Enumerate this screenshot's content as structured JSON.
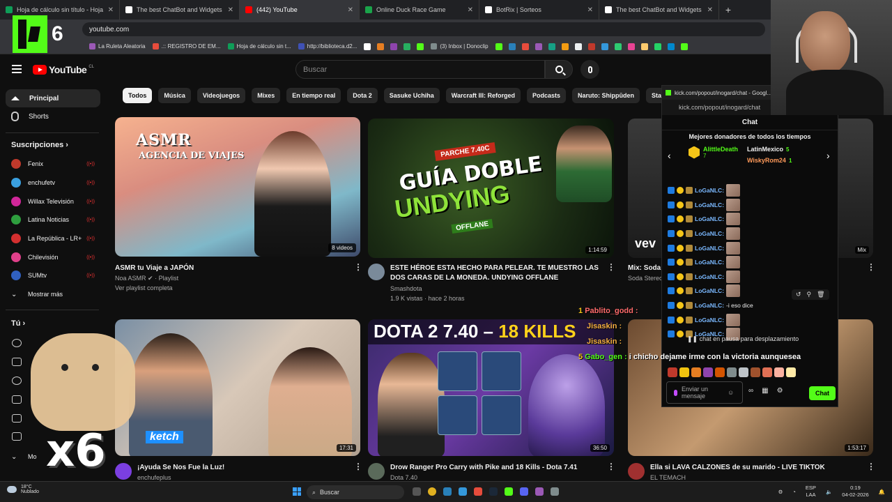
{
  "browser": {
    "tabs": [
      {
        "title": "Hoja de cálculo sin título - Hoja",
        "color": "#0f9d58"
      },
      {
        "title": "The best ChatBot and Widgets",
        "color": "#ffffff"
      },
      {
        "title": "(442) YouTube",
        "color": "#ff0000"
      },
      {
        "title": "Online Duck Race Game",
        "color": "#1aa34a"
      },
      {
        "title": "BotRix | Sorteos",
        "color": "#ffffff"
      },
      {
        "title": "The best ChatBot and Widgets",
        "color": "#ffffff"
      }
    ],
    "new_tab": "+",
    "url": "youtube.com",
    "bookmarks": [
      "La Ruleta Aleatoria",
      ".:: REGISTRO DE EM...",
      "Hoja de cálculo sin t...",
      "http://biblioteca.d2...",
      "(3) Inbox | Donoclip"
    ]
  },
  "overlay": {
    "k6": "6",
    "multiplier": "x6"
  },
  "youtube": {
    "logo": "YouTube",
    "country": "CL",
    "search_placeholder": "Buscar",
    "sidebar": {
      "home": "Principal",
      "shorts": "Shorts",
      "subs_header": "Suscripciones",
      "channels": [
        {
          "name": "Fenix",
          "color": "#c0392b"
        },
        {
          "name": "enchufetv",
          "color": "#3aa0e0"
        },
        {
          "name": "Willax Televisión",
          "color": "#d1279a"
        },
        {
          "name": "Latina Noticias",
          "color": "#2e9e3e"
        },
        {
          "name": "La República - LR+",
          "color": "#d32f2f"
        },
        {
          "name": "Chilevisión",
          "color": "#e0408a"
        },
        {
          "name": "SUMtv",
          "color": "#3060c0"
        }
      ],
      "show_more": "Mostrar más",
      "you_header": "Tú",
      "more_short": "Mo"
    },
    "chips": [
      "Todos",
      "Música",
      "Videojuegos",
      "Mixes",
      "En tiempo real",
      "Dota 2",
      "Sasuke Uchiha",
      "Warcraft III: Reforged",
      "Podcasts",
      "Naruto: Shippūden",
      "StarCraft"
    ],
    "videos": [
      {
        "title": "ASMR tu Viaje a JAPÓN",
        "channel": "Noa ASMR",
        "meta1": "Playlist",
        "meta2": "Ver playlist completa",
        "badge": "8 videos",
        "thumb_text1": "ASMR",
        "thumb_text2": "AGENCIA DE VIAJES"
      },
      {
        "title_line1": "ESTE HÉROE ESTA HECHO PARA PELEAR. TE MUESTRO LAS",
        "title_line2": "DOS CARAS DE LA MONEDA. UNDYING OFFLANE",
        "channel": "Smashdota",
        "meta": "1.9 K vistas · hace 2 horas",
        "duration": "1:14:59",
        "thumb_badge": "PARCHE 7.40C",
        "thumb_text1": "GUÍA DOBLE",
        "thumb_text2": "UNDYING",
        "thumb_text3": "OFFLANE"
      },
      {
        "title": "Mix: Soda",
        "channel": "Soda Stereo",
        "badge": "Mix",
        "thumb_text": "vev"
      },
      {
        "title": "¡Ayuda Se Nos Fue la Luz!",
        "channel": "enchufeplus",
        "duration": "17:31",
        "thumb_text": "ketch"
      },
      {
        "title": "Drow Ranger Pro Carry with Pike and 18 Kills - Dota 7.41",
        "channel": "Dota 7.40",
        "duration": "36:50",
        "thumb_text_a": "DOTA 2 7.40 –",
        "thumb_text_b": "18 KILLS"
      },
      {
        "title": "Ella si LAVA CALZONES de su marido - LIVE TIKTOK",
        "channel": "EL TEMACH",
        "duration": "1:53:17"
      }
    ]
  },
  "chat": {
    "window_title": "kick.com/popout/inogard/chat - Googl...",
    "url": "kick.com/popout/inogard/chat",
    "header": "Chat",
    "donors_title": "Mejores donadores de todos los tiempos",
    "top_donor": {
      "name": "AlittleDeath",
      "amount": "7"
    },
    "donor2": {
      "name": "LatinMexico",
      "amount": "5"
    },
    "donor3": {
      "name": "WiskyRom24",
      "amount": "1"
    },
    "user": "LoGaNLC:",
    "message": "-i eso dice",
    "pause_text": "chat en pausa para desplazamiento",
    "input_placeholder": "Enviar un mensaje",
    "send_button": "Chat",
    "accent": "#53fc18"
  },
  "stream_overlay": {
    "line1_user": "Pablito_godd :",
    "line2_user": "Jisaskin :",
    "line3_user": "Jisaskin :",
    "line4_user": "Gabo_gen :",
    "line4_msg": "i chicho dejame irme con la victoria aunquesea",
    "line1_badge": "1",
    "line4_badge": "5"
  },
  "taskbar": {
    "temp": "18°C",
    "weather": "Nublado",
    "search": "Buscar",
    "lang1": "ESP",
    "lang2": "LAA",
    "time": "0:19",
    "date": "04-02-2026"
  }
}
